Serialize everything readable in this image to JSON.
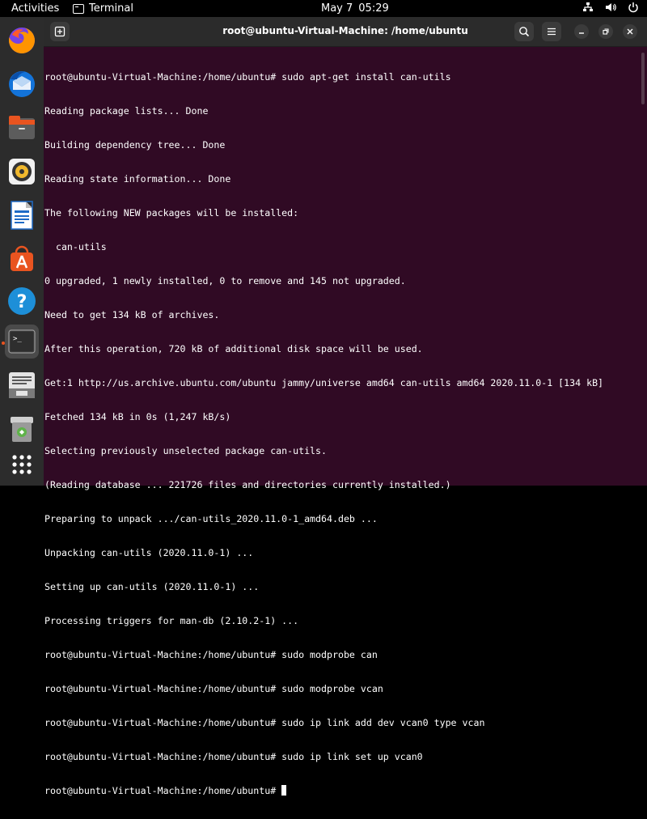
{
  "topbar": {
    "activities": "Activities",
    "app_name": "Terminal",
    "date": "May 7",
    "time": "05:29"
  },
  "dock": {
    "items": [
      {
        "name": "firefox-icon"
      },
      {
        "name": "thunderbird-icon"
      },
      {
        "name": "files-icon"
      },
      {
        "name": "rhythmbox-icon"
      },
      {
        "name": "writer-icon"
      },
      {
        "name": "app-center-icon"
      },
      {
        "name": "help-icon"
      },
      {
        "name": "terminal-icon"
      },
      {
        "name": "text-editor-icon"
      },
      {
        "name": "trash-icon"
      },
      {
        "name": "show-apps-icon"
      }
    ]
  },
  "window": {
    "title": "root@ubuntu-Virtual-Machine: /home/ubuntu"
  },
  "terminal": {
    "lines": [
      "root@ubuntu-Virtual-Machine:/home/ubuntu# sudo apt-get install can-utils",
      "Reading package lists... Done",
      "Building dependency tree... Done",
      "Reading state information... Done",
      "The following NEW packages will be installed:",
      "  can-utils",
      "0 upgraded, 1 newly installed, 0 to remove and 145 not upgraded.",
      "Need to get 134 kB of archives.",
      "After this operation, 720 kB of additional disk space will be used.",
      "Get:1 http://us.archive.ubuntu.com/ubuntu jammy/universe amd64 can-utils amd64 2020.11.0-1 [134 kB]",
      "Fetched 134 kB in 0s (1,247 kB/s)",
      "Selecting previously unselected package can-utils.",
      "(Reading database ... 221726 files and directories currently installed.)",
      "Preparing to unpack .../can-utils_2020.11.0-1_amd64.deb ...",
      "Unpacking can-utils (2020.11.0-1) ...",
      "Setting up can-utils (2020.11.0-1) ...",
      "Processing triggers for man-db (2.10.2-1) ...",
      "root@ubuntu-Virtual-Machine:/home/ubuntu# sudo modprobe can",
      "root@ubuntu-Virtual-Machine:/home/ubuntu# sudo modprobe vcan",
      "root@ubuntu-Virtual-Machine:/home/ubuntu# sudo ip link add dev vcan0 type vcan",
      "root@ubuntu-Virtual-Machine:/home/ubuntu# sudo ip link set up vcan0"
    ],
    "prompt": "root@ubuntu-Virtual-Machine:/home/ubuntu#"
  }
}
